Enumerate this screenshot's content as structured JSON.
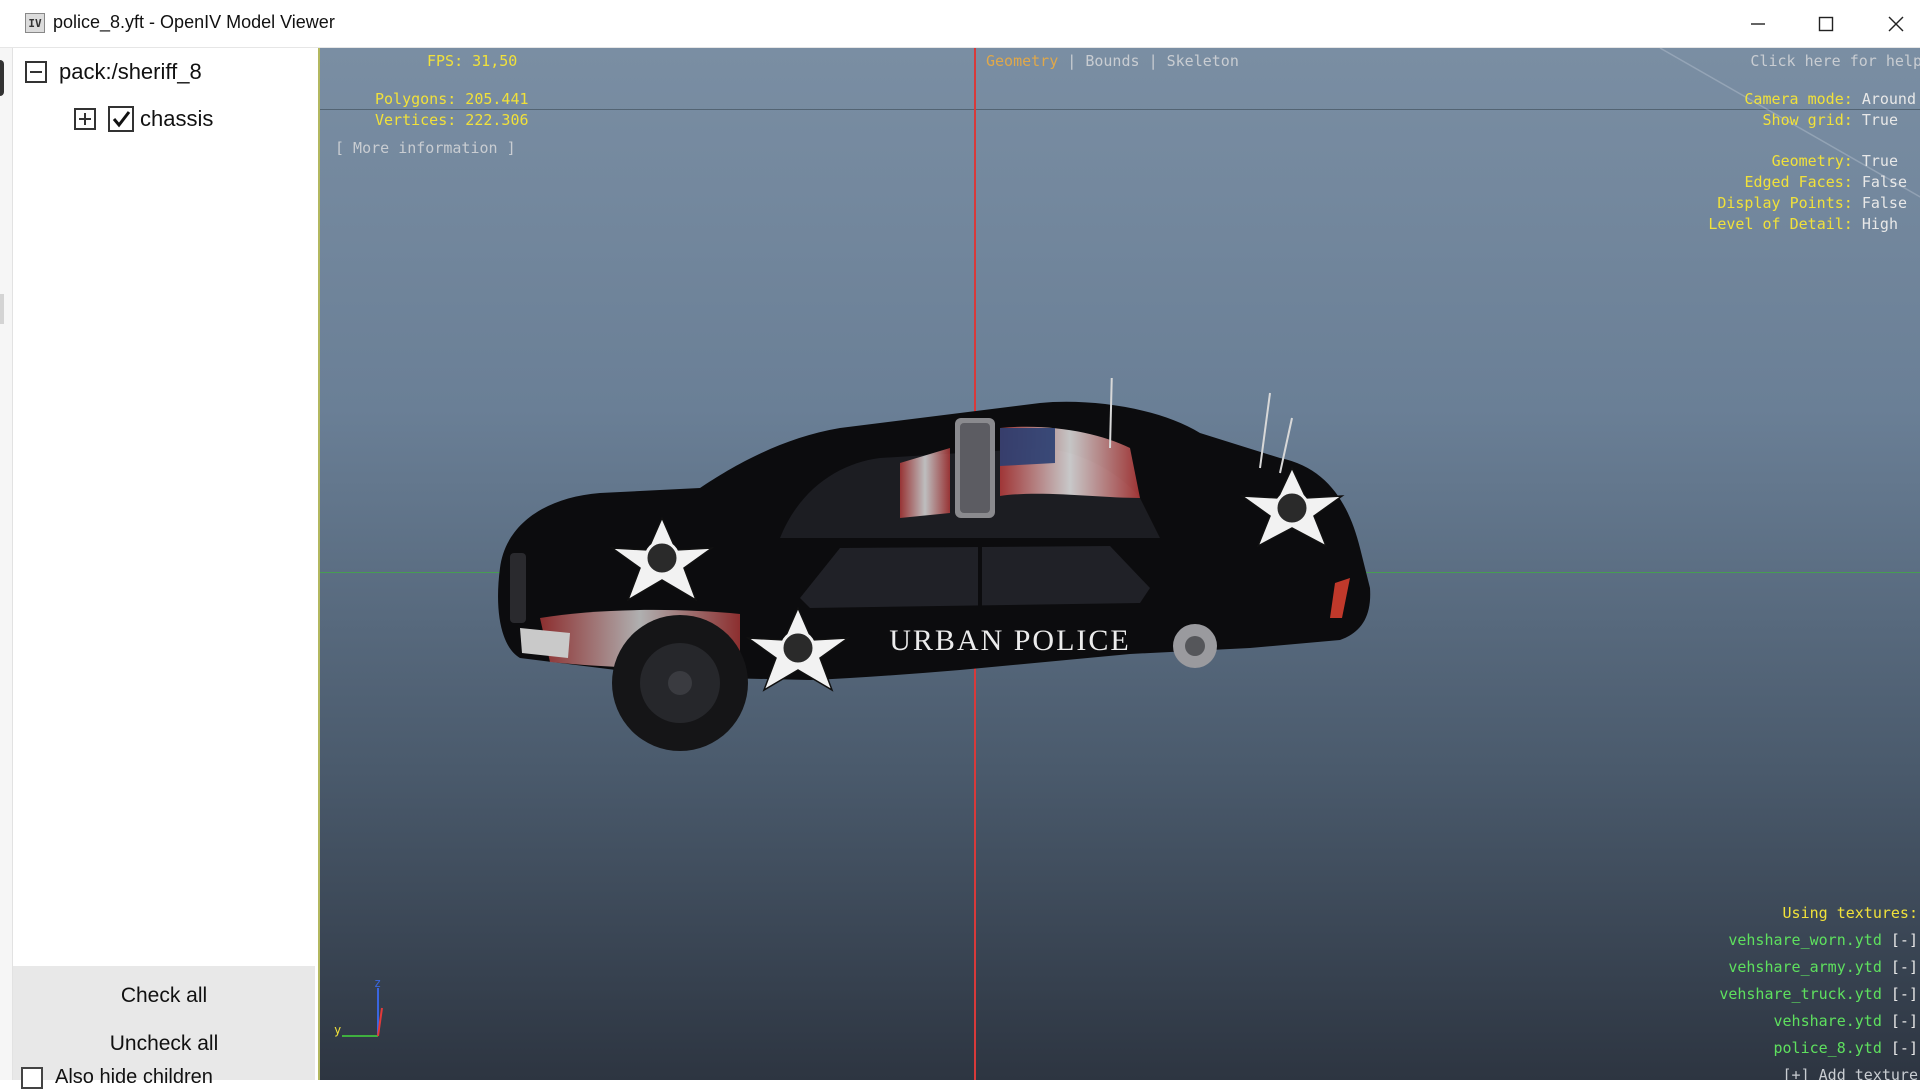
{
  "window": {
    "title": "police_8.yft - OpenIV Model Viewer",
    "icon_label": "IV",
    "icon": "openiv-app-icon",
    "controls": [
      "minimize-icon",
      "maximize-icon",
      "close-icon"
    ]
  },
  "sidebar": {
    "root": {
      "label": "pack:/sheriff_8",
      "expanded": true
    },
    "children": [
      {
        "label": "chassis",
        "checked": true,
        "expanded": false
      }
    ],
    "check_all": "Check all",
    "uncheck_all": "Uncheck all",
    "also_hide_children": "Also hide children"
  },
  "hud": {
    "fps": "FPS: 31,50",
    "polygons": "Polygons: 205.441",
    "vertices": "Vertices: 222.306",
    "more_info": "[ More information ]",
    "modes": {
      "geometry": "Geometry",
      "bounds": "Bounds",
      "skeleton": "Skeleton",
      "separator": "|"
    },
    "help": "Click here for help",
    "camera_mode": {
      "label": "Camera mode:",
      "value": "Around"
    },
    "show_grid": {
      "label": "Show grid:",
      "value": "True"
    },
    "geometry": {
      "label": "Geometry:",
      "value": "True"
    },
    "edged_faces": {
      "label": "Edged Faces:",
      "value": "False"
    },
    "display_points": {
      "label": "Display Points:",
      "value": "False"
    },
    "level_of_detail": {
      "label": "Level of Detail:",
      "value": "High"
    },
    "using_textures": "Using textures:",
    "textures": [
      {
        "name": "vehshare_worn.ytd",
        "action": "[-]"
      },
      {
        "name": "vehshare_army.ytd",
        "action": "[-]"
      },
      {
        "name": "vehshare_truck.ytd",
        "action": "[-]"
      },
      {
        "name": "vehshare.ytd",
        "action": "[-]"
      },
      {
        "name": "police_8.ytd",
        "action": "[-]"
      }
    ],
    "add_texture": "[+] Add texture",
    "axis": {
      "z": "z",
      "y": "y"
    }
  },
  "model": {
    "livery_text": "URBAN POLICE"
  },
  "colors": {
    "hud_yellow": "#f1e13a",
    "hud_green": "#5ee05e",
    "axis_red": "#e33a3a",
    "grid_green": "#3fb03f",
    "car_body": "#0c0c0e"
  }
}
